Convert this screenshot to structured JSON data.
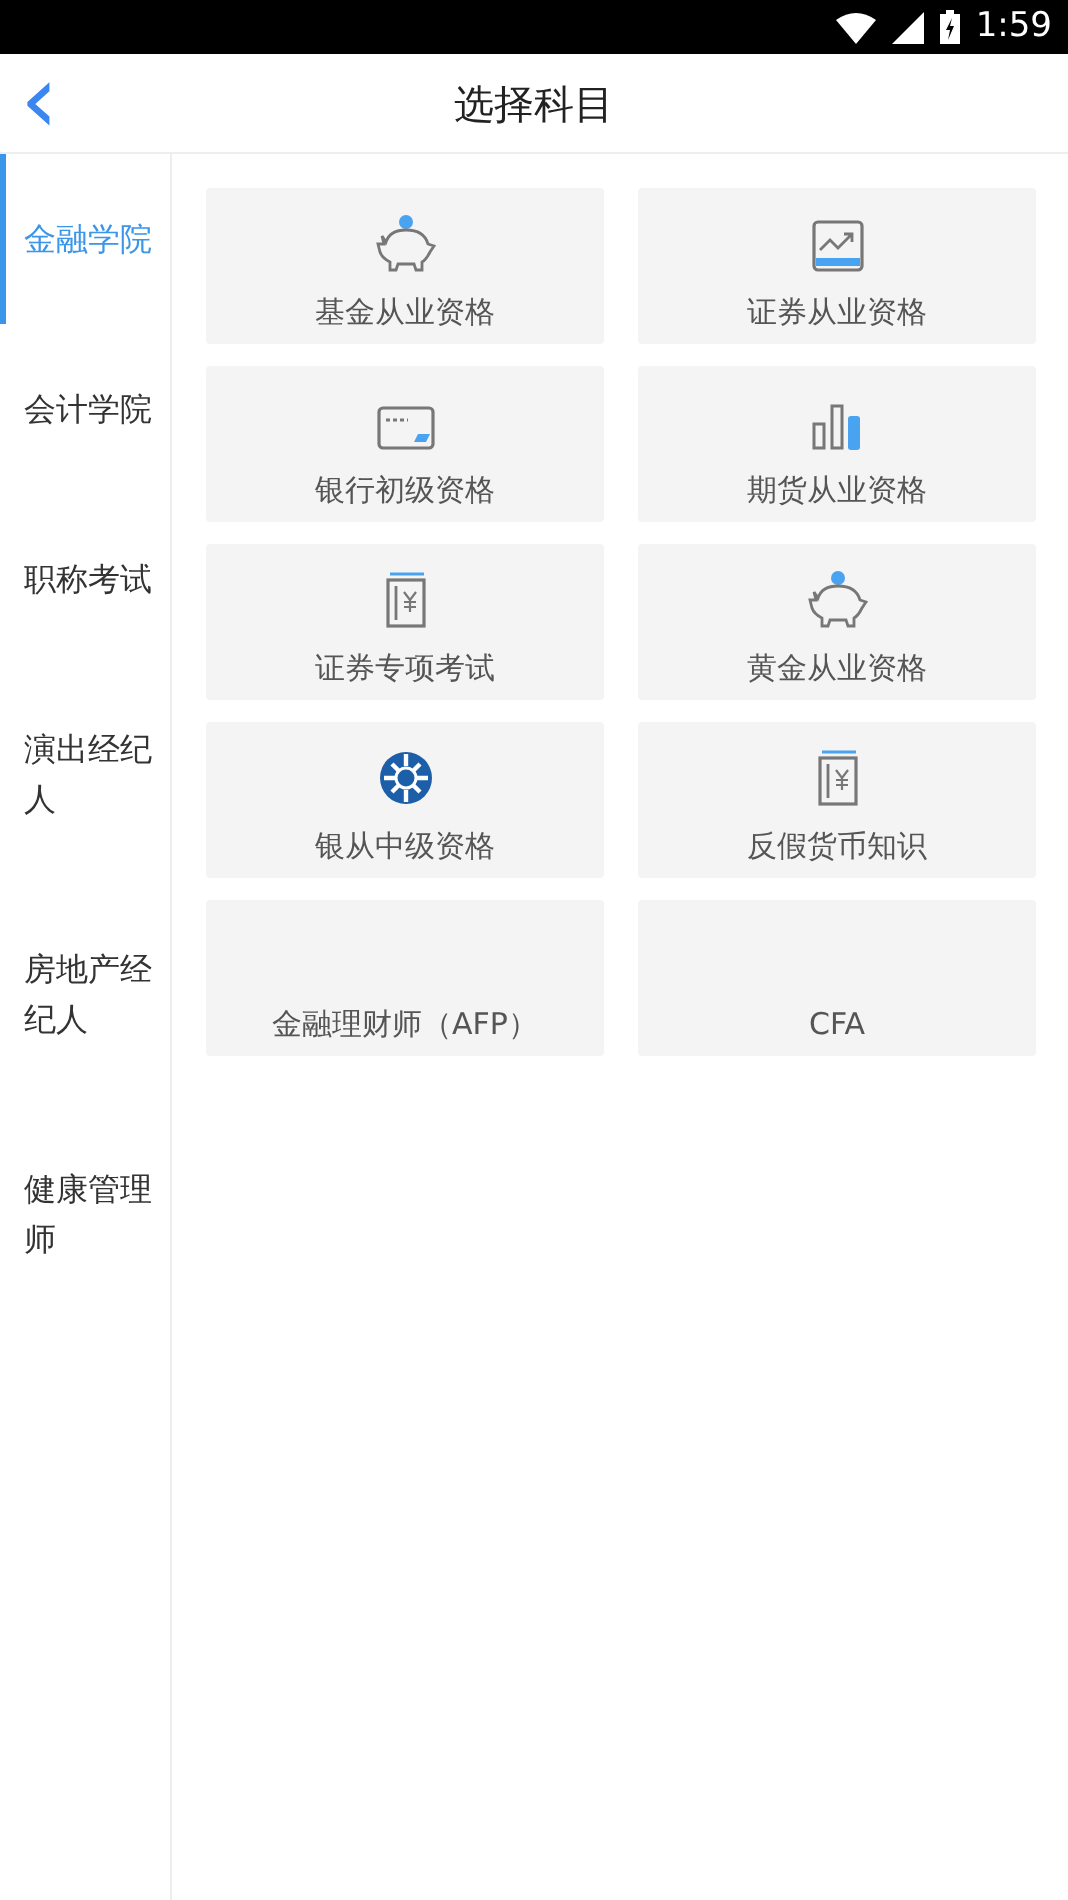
{
  "status_bar": {
    "time": "1:59"
  },
  "header": {
    "back": "‹",
    "title": "选择科目"
  },
  "sidebar": {
    "items": [
      {
        "label": "金融学院",
        "selected": true
      },
      {
        "label": "会计学院",
        "selected": false
      },
      {
        "label": "职称考试",
        "selected": false
      },
      {
        "label": "演出经纪人",
        "selected": false
      },
      {
        "label": "房地产经纪人",
        "selected": false
      },
      {
        "label": "健康管理师",
        "selected": false
      }
    ]
  },
  "subjects": [
    {
      "label": "基金从业资格",
      "kind": "piggy"
    },
    {
      "label": "证券从业资格",
      "kind": "chart"
    },
    {
      "label": "银行初级资格",
      "kind": "card"
    },
    {
      "label": "期货从业资格",
      "kind": "bars"
    },
    {
      "label": "证券专项考试",
      "kind": "book"
    },
    {
      "label": "黄金从业资格",
      "kind": "piggy"
    },
    {
      "label": "银从中级资格",
      "kind": "seal"
    },
    {
      "label": "反假货币知识",
      "kind": "book"
    },
    {
      "label": "金融理财师（AFP）",
      "kind": "plain"
    },
    {
      "label": "CFA",
      "kind": "plain"
    }
  ]
}
